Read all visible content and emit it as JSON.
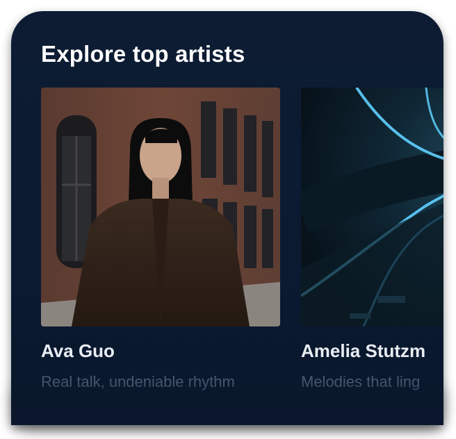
{
  "section": {
    "title": "Explore top artists"
  },
  "artists": [
    {
      "name": "Ava Guo",
      "tagline": "Real talk, undeniable rhythm",
      "image": "portrait-photo"
    },
    {
      "name": "Amelia Stutzm",
      "tagline": "Melodies that ling",
      "image": "neon-tunnel-photo"
    }
  ],
  "colors": {
    "card_background": "#0d1c33",
    "title": "#ffffff",
    "name": "#e9edf3",
    "tagline": "#5b6b80",
    "neon_accent": "#4fc3f7"
  }
}
